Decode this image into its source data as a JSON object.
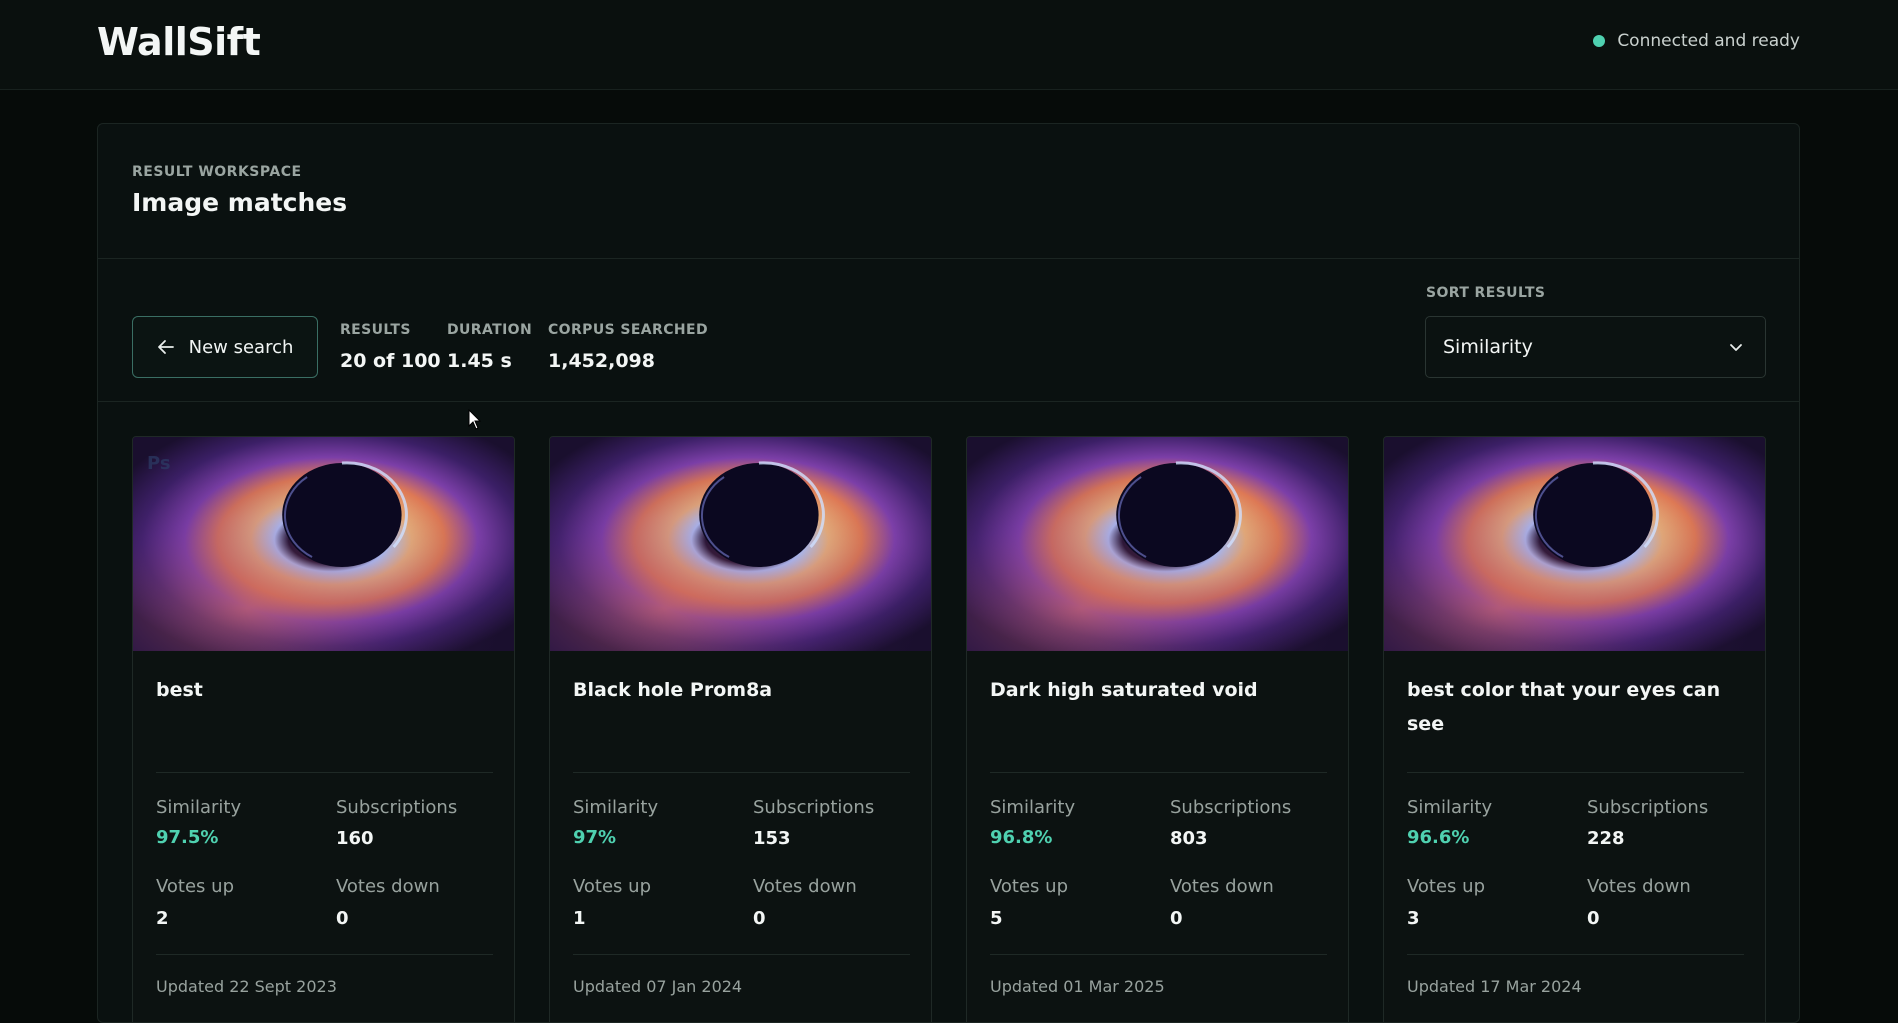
{
  "app": {
    "name": "WallSift",
    "status": "Connected and ready"
  },
  "workspace": {
    "eyebrow": "RESULT WORKSPACE",
    "title": "Image matches"
  },
  "toolbar": {
    "new_search": "New search",
    "stats": [
      {
        "label": "RESULTS",
        "value": "20 of 100"
      },
      {
        "label": "DURATION",
        "value": "1.45 s"
      },
      {
        "label": "CORPUS SEARCHED",
        "value": "1,452,098"
      }
    ],
    "sort_label": "SORT RESULTS",
    "sort_value": "Similarity"
  },
  "colors": {
    "accent": "#4fd1b0",
    "background": "#060b09",
    "panel": "#0a1110"
  },
  "metric_labels": {
    "similarity": "Similarity",
    "subscriptions": "Subscriptions",
    "votes_up": "Votes up",
    "votes_down": "Votes down"
  },
  "cards": [
    {
      "title": "best",
      "similarity": "97.5%",
      "subscriptions": "160",
      "votes_up": "2",
      "votes_down": "0",
      "updated": "Updated 22 Sept 2023",
      "badge": "Ps"
    },
    {
      "title": "Black hole Prom8a",
      "similarity": "97%",
      "subscriptions": "153",
      "votes_up": "1",
      "votes_down": "0",
      "updated": "Updated 07 Jan 2024"
    },
    {
      "title": "Dark high saturated void",
      "similarity": "96.8%",
      "subscriptions": "803",
      "votes_up": "5",
      "votes_down": "0",
      "updated": "Updated 01 Mar 2025"
    },
    {
      "title": "best color that your eyes can see",
      "similarity": "96.6%",
      "subscriptions": "228",
      "votes_up": "3",
      "votes_down": "0",
      "updated": "Updated 17 Mar 2024"
    }
  ]
}
